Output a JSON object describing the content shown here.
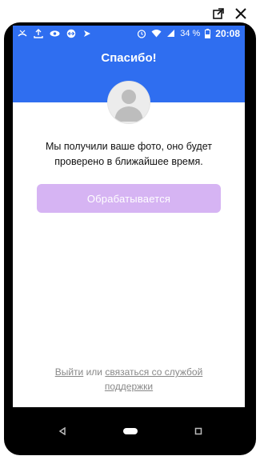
{
  "status_bar": {
    "battery": "34 %",
    "time": "20:08",
    "icons": [
      "missed-call-icon",
      "upload-icon",
      "eye-icon",
      "teamviewer-icon",
      "arrow-icon",
      "alarm-icon",
      "wifi-icon",
      "signal-icon",
      "battery-icon"
    ]
  },
  "header": {
    "title": "Спасибо!"
  },
  "avatar": {
    "icon": "user-silhouette-icon"
  },
  "message": {
    "line1": "Мы получили ваше фото, оно будет",
    "line2": "проверено в ближайшее время."
  },
  "processing_button": {
    "label": "Обрабатывается"
  },
  "footer": {
    "logout": "Выйти",
    "or": "или",
    "support_line1": "связаться со службой",
    "support_line2": "поддержки"
  },
  "colors": {
    "brand_blue": "#2f6ef0",
    "button_purple": "#d6b4f3"
  }
}
